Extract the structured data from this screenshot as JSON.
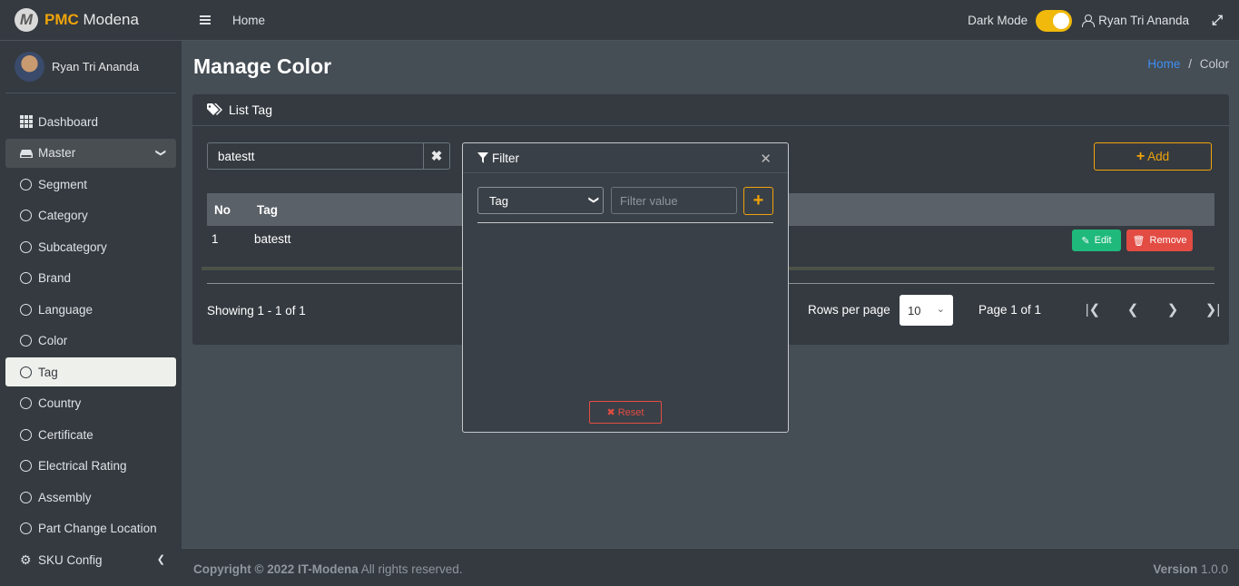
{
  "brand": {
    "bold": "PMC",
    "rest": "Modena",
    "logo": "M"
  },
  "user": {
    "name": "Ryan Tri Ananda"
  },
  "sidebar": {
    "items": [
      {
        "label": "Dashboard"
      },
      {
        "label": "Master"
      },
      {
        "label": "Segment"
      },
      {
        "label": "Category"
      },
      {
        "label": "Subcategory"
      },
      {
        "label": "Brand"
      },
      {
        "label": "Language"
      },
      {
        "label": "Color"
      },
      {
        "label": "Tag"
      },
      {
        "label": "Country"
      },
      {
        "label": "Certificate"
      },
      {
        "label": "Electrical Rating"
      },
      {
        "label": "Assembly"
      },
      {
        "label": "Part Change Location"
      },
      {
        "label": "SKU Config"
      }
    ]
  },
  "topbar": {
    "home": "Home",
    "dark_mode": "Dark Mode",
    "user": "Ryan Tri Ananda"
  },
  "page": {
    "title": "Manage Color",
    "breadcrumb_home": "Home",
    "breadcrumb_sep": "/",
    "breadcrumb_current": "Color"
  },
  "card": {
    "title": "List Tag",
    "search_value": "batestt",
    "add_label": "Add"
  },
  "table": {
    "headers": [
      "No",
      "Tag"
    ],
    "rows": [
      {
        "no": "1",
        "tag": "batestt"
      }
    ],
    "edit_label": "Edit",
    "remove_label": "Remove"
  },
  "pagination": {
    "showing": "Showing 1 - 1 of 1",
    "rows_per_page": "Rows per page",
    "rows_value": "10",
    "page_info": "Page 1 of 1"
  },
  "filter": {
    "title": "Filter",
    "field": "Tag",
    "placeholder": "Filter value",
    "reset": "Reset"
  },
  "footer": {
    "copyright": "Copyright © 2022 IT-Modena",
    "rights": " All rights reserved.",
    "version_label": "Version",
    "version": "1.0.0"
  },
  "colors": {
    "accent": "#f0a30a",
    "danger": "#e24c43",
    "success": "#1fb97b",
    "link": "#3f8ff0"
  }
}
